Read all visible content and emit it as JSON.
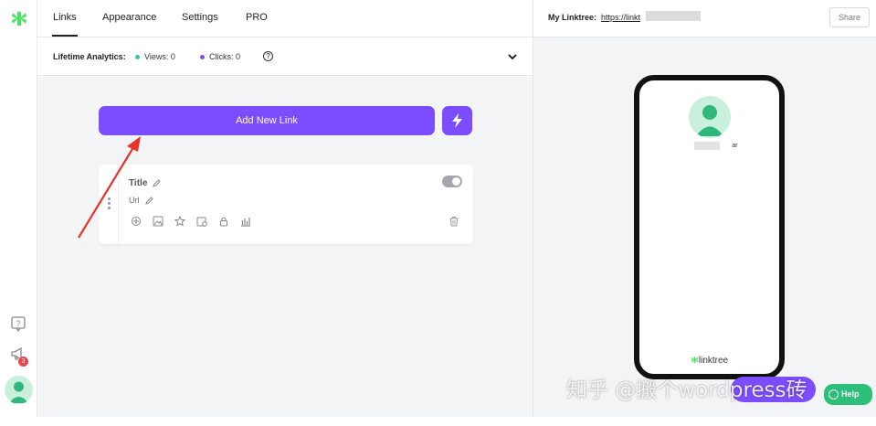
{
  "nav": {
    "tabs": [
      {
        "label": "Links",
        "active": true
      },
      {
        "label": "Appearance",
        "active": false
      },
      {
        "label": "Settings",
        "active": false
      },
      {
        "label": "PRO",
        "active": false
      }
    ]
  },
  "analytics": {
    "label": "Lifetime Analytics:",
    "views_label": "Views: 0",
    "clicks_label": "Clicks: 0",
    "views_color": "#39c690",
    "clicks_color": "#7c4dff",
    "help_glyph": "?"
  },
  "editor": {
    "add_button_label": "Add New Link",
    "quick_add_icon": "lightning-icon",
    "link_card": {
      "title": "Title",
      "url": "Url",
      "enabled": true,
      "tool_icons": [
        "redirect-icon",
        "thumbnail-icon",
        "star-icon",
        "schedule-icon",
        "lock-icon",
        "analytics-icon"
      ]
    }
  },
  "preview": {
    "my_linktree_label": "My Linktree:",
    "url_prefix": "https://linkt",
    "share_label": "Share",
    "profile_name_tail": "ar",
    "footer_brand": "linktree"
  },
  "rail": {
    "notification_count": "3"
  },
  "help_label": "Help",
  "watermark": "知乎 @搬个wordpress砖",
  "colors": {
    "accent": "#7c4dff",
    "brand_green": "#43e660",
    "help_green": "#2bbf7a"
  }
}
